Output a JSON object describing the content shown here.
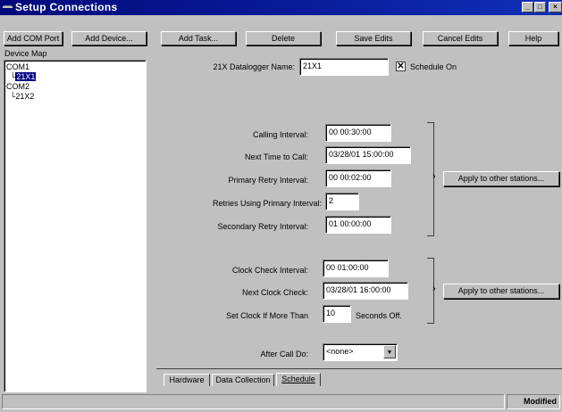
{
  "window": {
    "title": "Setup Connections"
  },
  "toolbar": {
    "add_com_port": "Add COM Port",
    "add_device": "Add Device...",
    "add_task": "Add Task...",
    "delete": "Delete",
    "save_edits": "Save Edits",
    "cancel_edits": "Cancel Edits",
    "help": "Help"
  },
  "device_map": {
    "header": "Device Map",
    "items": [
      "COM1",
      "21X1",
      "COM2",
      "21X2"
    ]
  },
  "form": {
    "datalogger_name_label": "21X Datalogger Name:",
    "datalogger_name": "21X1",
    "schedule_on_label": "Schedule On",
    "schedule_on": true,
    "calling_interval_label": "Calling Interval:",
    "calling_interval": "00 00:30:00",
    "next_time_label": "Next Time to Call:",
    "next_time": "03/28/01 15:00:00",
    "primary_retry_label": "Primary Retry Interval:",
    "primary_retry": "00 00:02:00",
    "retries_label": "Retries Using Primary Interval:",
    "retries": "2",
    "secondary_retry_label": "Secondary Retry Interval:",
    "secondary_retry": "01 00:00:00",
    "apply_label": "Apply to other stations...",
    "clock_check_label": "Clock Check Interval:",
    "clock_check": "00 01:00:00",
    "next_clock_label": "Next Clock Check:",
    "next_clock": "03/28/01 16:00:00",
    "set_clock_label": "Set Clock If More Than",
    "set_clock": "10",
    "seconds_off_label": "Seconds Off.",
    "after_call_label": "After Call Do:",
    "after_call": "<none>"
  },
  "tabs": [
    "Hardware",
    "Data Collection",
    "Schedule"
  ],
  "status": {
    "modified": "Modified"
  }
}
